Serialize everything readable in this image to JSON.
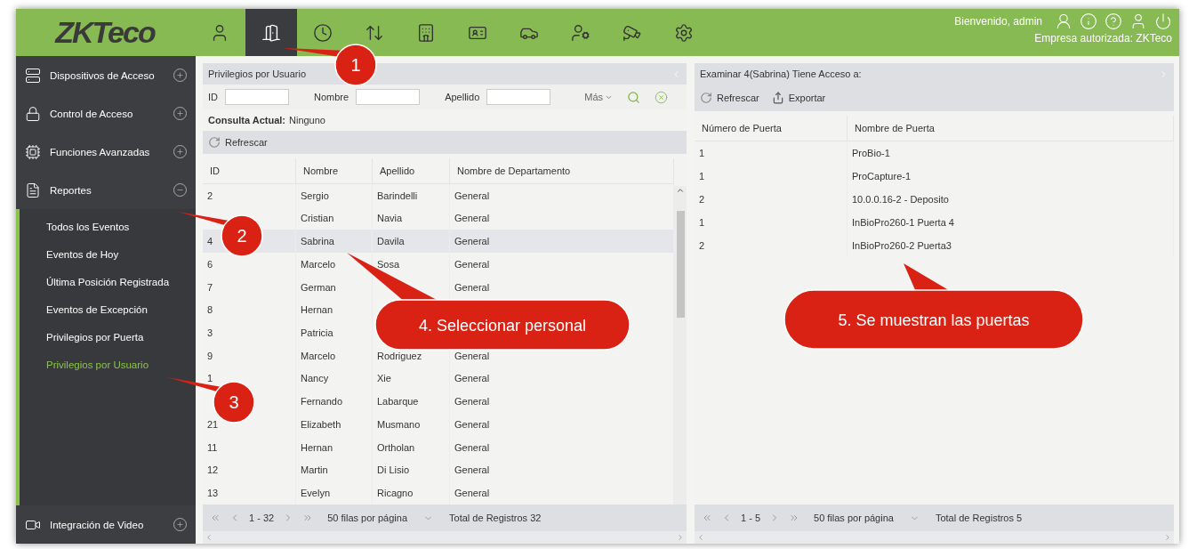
{
  "header": {
    "logo": "ZKTeco",
    "nav": [
      {
        "selected": false
      },
      {
        "selected": true
      },
      {
        "selected": false
      },
      {
        "selected": false
      },
      {
        "selected": false
      },
      {
        "selected": false
      },
      {
        "selected": false
      },
      {
        "selected": false
      },
      {
        "selected": false
      },
      {
        "selected": false
      }
    ],
    "welcome": "Bienvenido, admin",
    "company": "Empresa autorizada: ZKTeco"
  },
  "sidebar": {
    "items": [
      {
        "label": "Dispositivos de Acceso",
        "expanded": false
      },
      {
        "label": "Control de Acceso",
        "expanded": false
      },
      {
        "label": "Funciones Avanzadas",
        "expanded": false
      },
      {
        "label": "Reportes",
        "expanded": true,
        "children": [
          {
            "label": "Todos los Eventos",
            "selected": false
          },
          {
            "label": "Eventos de Hoy",
            "selected": false
          },
          {
            "label": "Última Posición Registrada",
            "selected": false
          },
          {
            "label": "Eventos de Excepción",
            "selected": false
          },
          {
            "label": "Privilegios por Puerta",
            "selected": false
          },
          {
            "label": "Privilegios por Usuario",
            "selected": true
          }
        ]
      }
    ],
    "bottom_item": {
      "label": "Integración de Video",
      "expanded": false
    }
  },
  "left_panel": {
    "title": "Privilegios por Usuario",
    "filters": [
      {
        "label": "ID"
      },
      {
        "label": "Nombre"
      },
      {
        "label": "Apellido"
      }
    ],
    "more": "Más",
    "query_label": "Consulta Actual:",
    "query_value": "Ninguno",
    "refresh": "Refrescar",
    "columns": [
      "ID",
      "Nombre",
      "Apellido",
      "Nombre de Departamento"
    ],
    "rows": [
      {
        "id": "2",
        "nombre": "Sergio",
        "apellido": "Barindelli",
        "departamento": "General",
        "selected": false
      },
      {
        "nombre": "Cristian",
        "apellido": "Navia",
        "departamento": "General",
        "selected": false
      },
      {
        "id": "4",
        "nombre": "Sabrina",
        "apellido": "Davila",
        "departamento": "General",
        "selected": true
      },
      {
        "id": "6",
        "nombre": "Marcelo",
        "apellido": "Sosa",
        "departamento": "General",
        "selected": false
      },
      {
        "id": "7",
        "nombre": "German",
        "departamento": "General",
        "selected": false
      },
      {
        "id": "8",
        "nombre": "Hernan",
        "selected": false
      },
      {
        "id": "3",
        "nombre": "Patricia",
        "selected": false
      },
      {
        "id": "9",
        "nombre": "Marcelo",
        "apellido": "Rodriguez",
        "departamento": "General",
        "selected": false
      },
      {
        "id": "1",
        "nombre": "Nancy",
        "apellido": "Xie",
        "departamento": "General",
        "selected": false
      },
      {
        "nombre": "Fernando",
        "apellido": "Labarque",
        "departamento": "General",
        "selected": false
      },
      {
        "id": "21",
        "nombre": "Elizabeth",
        "apellido": "Musmano",
        "departamento": "General",
        "selected": false
      },
      {
        "id": "11",
        "nombre": "Hernan",
        "apellido": "Ortholan",
        "departamento": "General",
        "selected": false
      },
      {
        "id": "12",
        "nombre": "Martin",
        "apellido": "Di Lisio",
        "departamento": "General",
        "selected": false
      },
      {
        "id": "13",
        "nombre": "Evelyn",
        "apellido": "Ricagno",
        "departamento": "General",
        "selected": false
      }
    ],
    "pager": {
      "range": "1 - 32",
      "per_page": "50 filas por página",
      "total": "Total de Registros 32"
    }
  },
  "right_panel": {
    "title": "Examinar 4(Sabrina) Tiene Acceso a:",
    "actions": [
      "Refrescar",
      "Exportar"
    ],
    "columns": [
      "Número de Puerta",
      "Nombre de Puerta"
    ],
    "rows": [
      [
        "1",
        "ProBio-1"
      ],
      [
        "1",
        "ProCapture-1"
      ],
      [
        "2",
        "10.0.0.16-2 - Deposito"
      ],
      [
        "1",
        "InBioPro260-1 Puerta 4"
      ],
      [
        "2",
        "InBioPro260-2 Puerta3"
      ]
    ],
    "pager": {
      "range": "1 - 5",
      "per_page": "50 filas por página",
      "total": "Total de Registros 5"
    }
  },
  "callouts": [
    {
      "kind": "circle",
      "text": "1"
    },
    {
      "kind": "circle",
      "text": "2"
    },
    {
      "kind": "circle",
      "text": "3"
    },
    {
      "kind": "bubble",
      "text": "4. Seleccionar personal"
    },
    {
      "kind": "bubble",
      "text": "5. Se muestran las puertas"
    }
  ]
}
